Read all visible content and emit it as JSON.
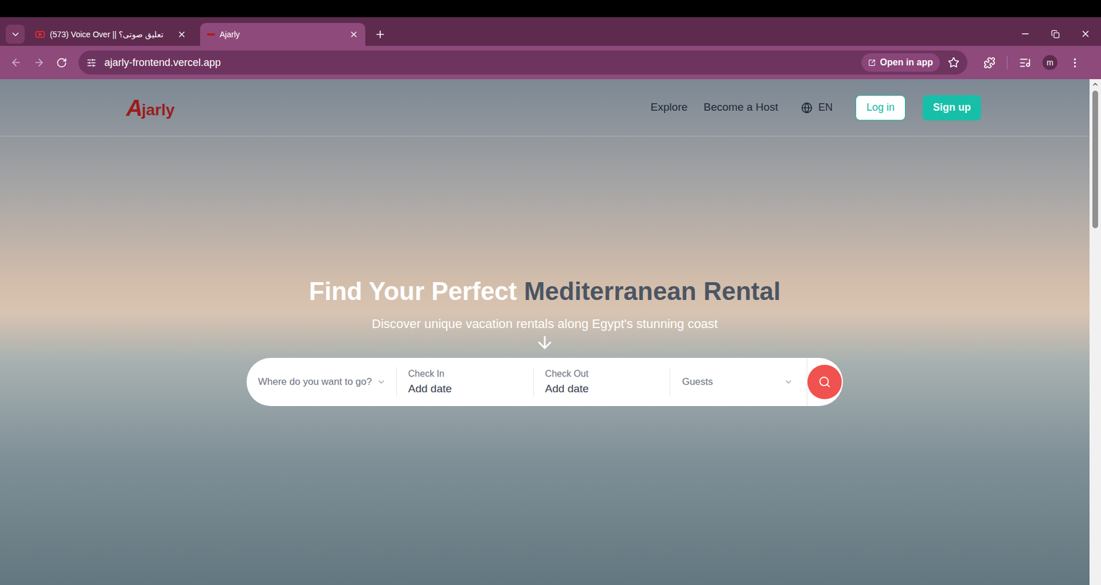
{
  "window": {
    "tabs": [
      {
        "label": "(573) Voice Over || تعليق صوتى؟",
        "selected": false
      },
      {
        "label": "Ajarly",
        "selected": true
      }
    ]
  },
  "address_bar": {
    "url": "ajarly-frontend.vercel.app",
    "open_in_app": "Open in app",
    "profile": "m"
  },
  "nav": {
    "logo_mark": "A",
    "logo_text": "jarly",
    "links": [
      "Explore",
      "Become a Host"
    ],
    "language": "EN",
    "login": "Log in",
    "signup": "Sign up"
  },
  "hero": {
    "title_light": "Find Your Perfect",
    "title_dark": "Mediterranean Rental",
    "subtitle": "Discover unique vacation rentals along Egypt's stunning coast"
  },
  "search": {
    "destination_placeholder": "Where do you want to go?",
    "check_in_label": "Check In",
    "check_in_value": "Add date",
    "check_out_label": "Check Out",
    "check_out_value": "Add date",
    "guests_placeholder": "Guests"
  }
}
